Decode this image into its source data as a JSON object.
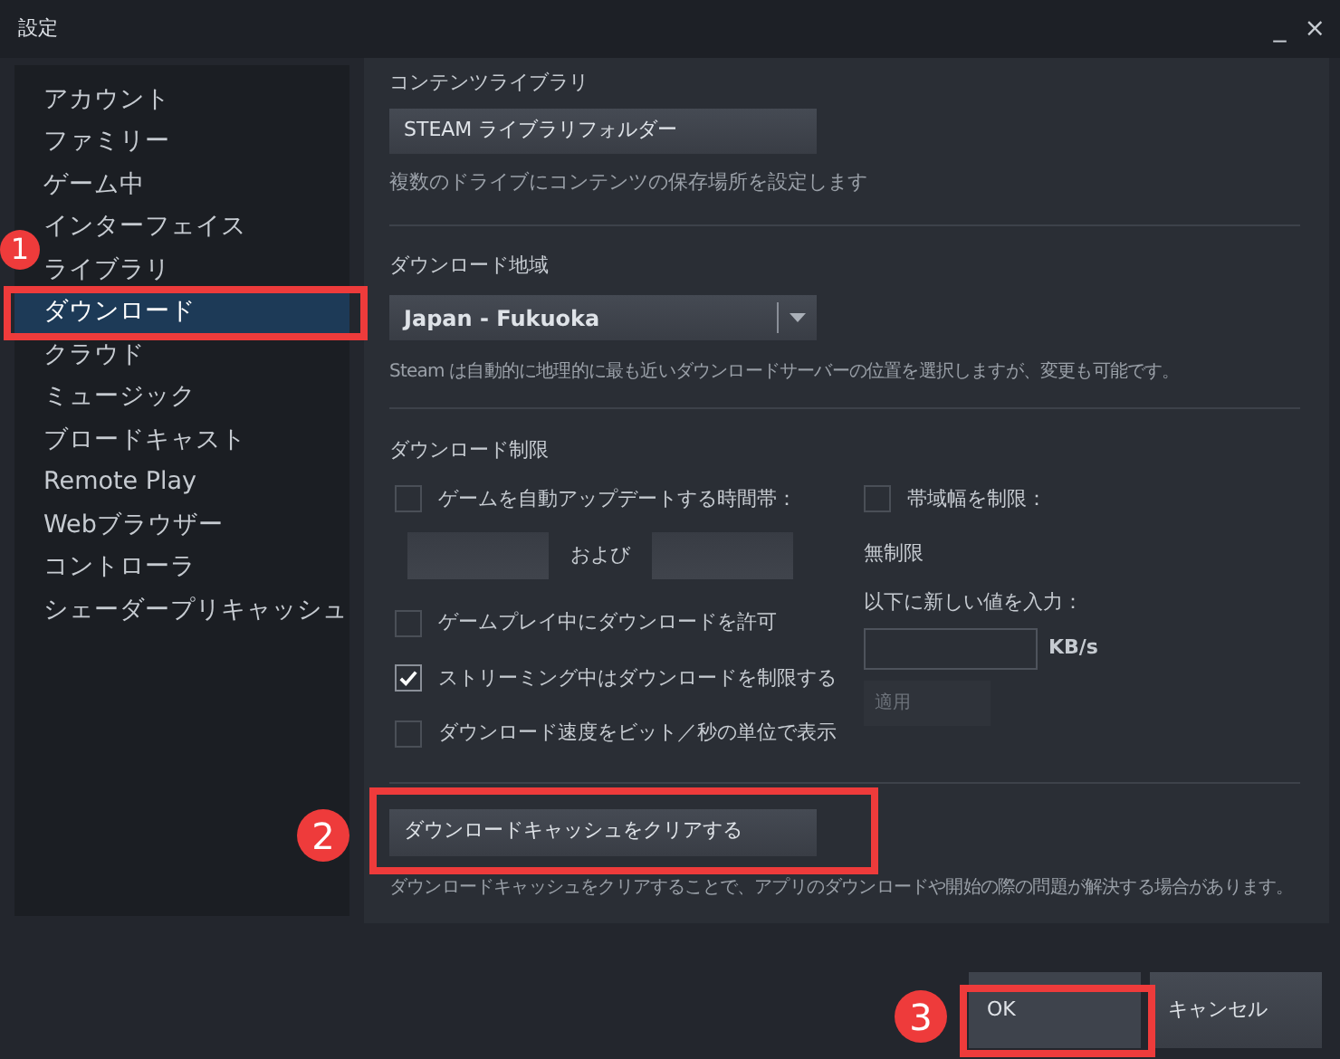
{
  "window": {
    "title": "設定",
    "controls": [
      "_",
      "×"
    ]
  },
  "sidebar": {
    "items": [
      {
        "label": "アカウント",
        "selected": false
      },
      {
        "label": "ファミリー",
        "selected": false
      },
      {
        "label": "ゲーム中",
        "selected": false
      },
      {
        "label": "インターフェイス",
        "selected": false
      },
      {
        "label": "ライブラリ",
        "selected": false
      },
      {
        "label": "ダウンロード",
        "selected": true
      },
      {
        "label": "クラウド",
        "selected": false
      },
      {
        "label": "ミュージック",
        "selected": false
      },
      {
        "label": "ブロードキャスト",
        "selected": false
      },
      {
        "label": "Remote Play",
        "selected": false
      },
      {
        "label": "Webブラウザー",
        "selected": false
      },
      {
        "label": "コントローラ",
        "selected": false
      },
      {
        "label": "シェーダープリキャッシュ",
        "selected": false
      }
    ]
  },
  "content_library": {
    "heading": "コンテンツライブラリ",
    "button": "STEAM ライブラリフォルダー",
    "description": "複数のドライブにコンテンツの保存場所を設定します"
  },
  "download_region": {
    "heading": "ダウンロード地域",
    "dropdown": "Japan - Fukuoka",
    "description": "Steam は自動的に地理的に最も近いダウンロードサーバーの位置を選択しますが、変更も可能です。"
  },
  "download_limits": {
    "heading": "ダウンロード制限",
    "auto_update": {
      "label": "ゲームを自動アップデートする時間帯：",
      "checked": false,
      "between": "および"
    },
    "options": [
      {
        "label": "ゲームプレイ中にダウンロードを許可",
        "checked": false
      },
      {
        "label": "ストリーミング中はダウンロードを制限する",
        "checked": true
      },
      {
        "label": "ダウンロード速度をビット／秒の単位で表示",
        "checked": false
      }
    ],
    "bandwidth": {
      "label": "帯域幅を制限：",
      "checked": false,
      "current": "無制限",
      "prompt": "以下に新しい値を入力：",
      "unit": "KB/s",
      "apply": "適用"
    }
  },
  "clear_cache": {
    "button": "ダウンロードキャッシュをクリアする",
    "description": "ダウンロードキャッシュをクリアすることで、アプリのダウンロードや開始の際の問題が解決する場合があります。"
  },
  "footer": {
    "buttons": [
      {
        "label": "OK",
        "kind": "primary"
      },
      {
        "label": "キャンセル",
        "kind": "secondary"
      }
    ]
  },
  "annotations": [
    {
      "number": "1"
    },
    {
      "number": "2"
    },
    {
      "number": "3"
    }
  ]
}
